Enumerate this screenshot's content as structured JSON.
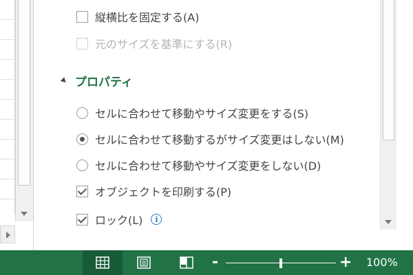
{
  "size_options": {
    "lock_aspect": {
      "label": "縦横比を固定する(A)",
      "checked": false
    },
    "relative_original": {
      "label": "元のサイズを基準にする(R)",
      "checked": false,
      "disabled": true
    }
  },
  "properties": {
    "title": "プロパティ",
    "radio_options": [
      {
        "label": "セルに合わせて移動やサイズ変更をする(S)",
        "checked": false
      },
      {
        "label": "セルに合わせて移動するがサイズ変更はしない(M)",
        "checked": true
      },
      {
        "label": "セルに合わせて移動やサイズ変更をしない(D)",
        "checked": false
      }
    ],
    "print_object": {
      "label": "オブジェクトを印刷する(P)",
      "checked": true
    },
    "lock": {
      "label": "ロック(L)",
      "checked": true
    }
  },
  "statusbar": {
    "zoom_minus": "-",
    "zoom_plus": "+",
    "zoom_percent": "100%",
    "zoom_fraction": 0.5,
    "background": "#217346",
    "active_view": "normal"
  },
  "icons": [
    "normal-view-icon",
    "page-layout-view-icon",
    "page-break-preview-icon",
    "info-icon"
  ]
}
